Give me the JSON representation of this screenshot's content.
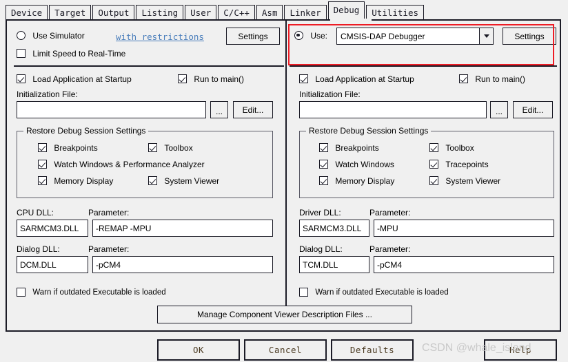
{
  "tabs": [
    {
      "label": "Device",
      "active": false
    },
    {
      "label": "Target",
      "active": false
    },
    {
      "label": "Output",
      "active": false
    },
    {
      "label": "Listing",
      "active": false
    },
    {
      "label": "User",
      "active": false
    },
    {
      "label": "C/C++",
      "active": false
    },
    {
      "label": "Asm",
      "active": false
    },
    {
      "label": "Linker",
      "active": false
    },
    {
      "label": "Debug",
      "active": true
    },
    {
      "label": "Utilities",
      "active": false
    }
  ],
  "simulator": {
    "radio_label": "Use Simulator",
    "radio_checked": false,
    "restrictions_link": "with restrictions",
    "settings_button": "Settings",
    "limit_speed_label": "Limit Speed to Real-Time",
    "limit_speed_checked": false
  },
  "driver": {
    "radio_label": "Use:",
    "radio_checked": true,
    "selected_driver": "CMSIS-DAP Debugger",
    "settings_button": "Settings",
    "dropdown_icon": "chevron-down-icon"
  },
  "left": {
    "load_app_label": "Load Application at Startup",
    "load_app_checked": true,
    "run_to_main_label": "Run to main()",
    "run_to_main_checked": true,
    "init_file_label": "Initialization File:",
    "init_file_value": "",
    "browse_button": "...",
    "edit_button": "Edit...",
    "restore_group_title": "Restore Debug Session Settings",
    "restore_items": [
      {
        "label": "Breakpoints",
        "checked": true
      },
      {
        "label": "Toolbox",
        "checked": true
      },
      {
        "label": "Watch Windows & Performance Analyzer",
        "checked": true
      },
      {
        "label": "Memory Display",
        "checked": true
      },
      {
        "label": "System Viewer",
        "checked": true
      }
    ],
    "cpu_dll_label": "CPU DLL:",
    "cpu_dll_value": "SARMCM3.DLL",
    "cpu_param_label": "Parameter:",
    "cpu_param_value": "-REMAP -MPU",
    "dialog_dll_label": "Dialog DLL:",
    "dialog_dll_value": "DCM.DLL",
    "dialog_param_label": "Parameter:",
    "dialog_param_value": "-pCM4",
    "warn_label": "Warn if outdated Executable is loaded",
    "warn_checked": false
  },
  "right": {
    "load_app_label": "Load Application at Startup",
    "load_app_checked": true,
    "run_to_main_label": "Run to main()",
    "run_to_main_checked": true,
    "init_file_label": "Initialization File:",
    "init_file_value": "",
    "browse_button": "...",
    "edit_button": "Edit...",
    "restore_group_title": "Restore Debug Session Settings",
    "restore_items": [
      {
        "label": "Breakpoints",
        "checked": true
      },
      {
        "label": "Toolbox",
        "checked": true
      },
      {
        "label": "Watch Windows",
        "checked": true
      },
      {
        "label": "Tracepoints",
        "checked": true
      },
      {
        "label": "Memory Display",
        "checked": true
      },
      {
        "label": "System Viewer",
        "checked": true
      }
    ],
    "driver_dll_label": "Driver DLL:",
    "driver_dll_value": "SARMCM3.DLL",
    "driver_param_label": "Parameter:",
    "driver_param_value": "-MPU",
    "dialog_dll_label": "Dialog DLL:",
    "dialog_dll_value": "TCM.DLL",
    "dialog_param_label": "Parameter:",
    "dialog_param_value": "-pCM4",
    "warn_label": "Warn if outdated Executable is loaded",
    "warn_checked": false
  },
  "manage_button": "Manage Component Viewer Description Files ...",
  "footer": {
    "ok": "OK",
    "cancel": "Cancel",
    "defaults": "Defaults",
    "help": "Help"
  },
  "watermark": "CSDN @whale_island",
  "colors": {
    "highlight": "#ee1c25",
    "link": "#4a7ebb",
    "dialog_bg": "#f0f0f0",
    "border": "#1b1b26"
  }
}
